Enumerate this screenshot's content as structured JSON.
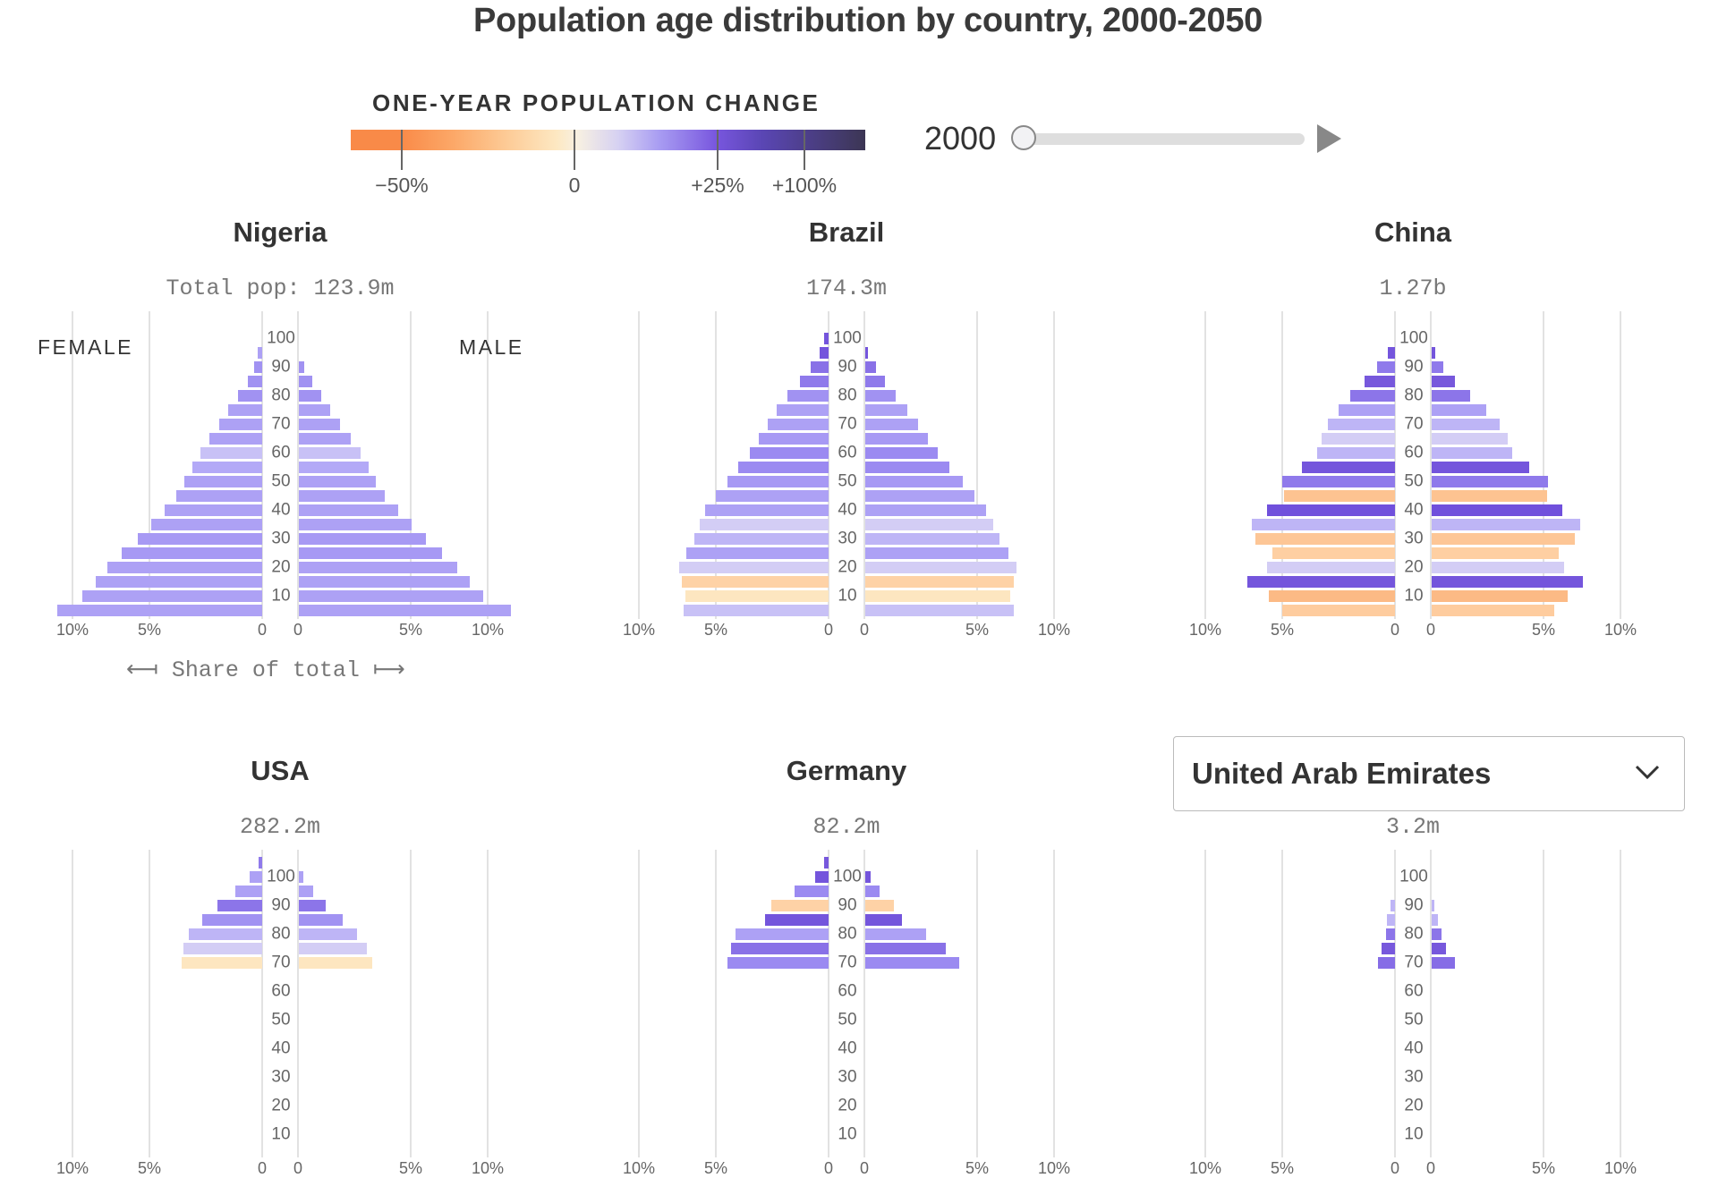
{
  "title": "Population age distribution by country, 2000-2050",
  "legend": {
    "title": "ONE-YEAR POPULATION CHANGE",
    "ticks": [
      {
        "value": -50,
        "label": "−50%"
      },
      {
        "value": 0,
        "label": "0"
      },
      {
        "value": 25,
        "label": "+25%"
      },
      {
        "value": 100,
        "label": "+100%"
      }
    ],
    "color_stops": [
      {
        "change": -50,
        "color": "#f98a48"
      },
      {
        "change": -15,
        "color": "#fcb781"
      },
      {
        "change": -6,
        "color": "#fed2a6"
      },
      {
        "change": -1,
        "color": "#fdebc6"
      },
      {
        "change": 0,
        "color": "#f6f1e6"
      },
      {
        "change": 2,
        "color": "#d3cdf5"
      },
      {
        "change": 5,
        "color": "#b3a9f7"
      },
      {
        "change": 10,
        "color": "#9582ef"
      },
      {
        "change": 20,
        "color": "#7758dc"
      },
      {
        "change": 25,
        "color": "#7050dc"
      },
      {
        "change": 100,
        "color": "#3c3654"
      }
    ]
  },
  "slider": {
    "year_label": "2000",
    "min": 2000,
    "max": 2050,
    "value": 2000,
    "play_icon": "play-icon"
  },
  "labels": {
    "female": "FEMALE",
    "male": "MALE",
    "share_of_total": "Share of total"
  },
  "dropdown": {
    "selected": "United Arab Emirates",
    "icon": "chevron-down-icon"
  },
  "age_groups": [
    "0-4",
    "5-9",
    "10-14",
    "15-19",
    "20-24",
    "25-29",
    "30-34",
    "35-39",
    "40-44",
    "45-49",
    "50-54",
    "55-59",
    "60-64",
    "65-69",
    "70-74",
    "75-79",
    "80-84",
    "85-89",
    "90-94",
    "95-99",
    "100+"
  ],
  "age_ticks": [
    "10",
    "20",
    "30",
    "40",
    "50",
    "60",
    "70",
    "80",
    "90",
    "100"
  ],
  "x_ticks": {
    "female": [
      "10%",
      "5%",
      "0"
    ],
    "male": [
      "0",
      "5%",
      "10%"
    ]
  },
  "chart_data": [
    {
      "type": "bar",
      "orientation": "population-pyramid",
      "country": "Nigeria",
      "pop_label": "Total pop: 123.9m",
      "xlabel": "Share of total",
      "xlim": [
        0,
        10
      ],
      "x_unit": "% of total population",
      "female": [
        11.1,
        9.3,
        8.4,
        7.6,
        6.7,
        5.7,
        4.9,
        4.1,
        3.5,
        3.04,
        2.63,
        2.24,
        1.82,
        1.39,
        1.0,
        0.64,
        0.31,
        0.15,
        0.07,
        0,
        0
      ],
      "male": [
        11.6,
        9.6,
        8.7,
        7.85,
        6.85,
        5.85,
        5.0,
        4.24,
        3.5,
        2.99,
        2.63,
        2.24,
        1.78,
        1.32,
        0.9,
        0.57,
        0.29,
        0.09,
        0,
        0,
        0
      ],
      "change": [
        6,
        6,
        6,
        6,
        7,
        7,
        6,
        6,
        6,
        6,
        5,
        3,
        6,
        6,
        6,
        8,
        8,
        8,
        6,
        0,
        0
      ]
    },
    {
      "type": "bar",
      "orientation": "population-pyramid",
      "country": "Brazil",
      "pop_label": "174.3m",
      "xlim": [
        0,
        10
      ],
      "female": [
        7.0,
        6.85,
        7.08,
        7.25,
        6.8,
        6.3,
        5.96,
        5.64,
        5.0,
        4.34,
        3.7,
        3.08,
        2.63,
        2.2,
        1.78,
        1.32,
        0.81,
        0.42,
        0.17,
        0.07,
        0
      ],
      "male": [
        7.2,
        6.96,
        7.2,
        7.37,
        6.9,
        6.3,
        5.9,
        5.5,
        4.8,
        4.14,
        3.4,
        2.76,
        2.28,
        1.82,
        1.35,
        0.87,
        0.5,
        0.22,
        0.03,
        0,
        0
      ],
      "change": [
        3,
        -2,
        -6,
        2,
        6,
        4,
        2,
        6,
        6,
        7,
        9,
        9,
        7,
        6,
        6,
        8,
        12,
        14,
        22,
        22,
        0
      ]
    },
    {
      "type": "bar",
      "orientation": "population-pyramid",
      "country": "China",
      "pop_label": "1.27b",
      "xlim": [
        0,
        10
      ],
      "female": [
        5.0,
        5.8,
        7.14,
        5.9,
        5.6,
        6.63,
        6.9,
        5.9,
        4.9,
        5.0,
        3.85,
        3.04,
        2.8,
        2.5,
        1.97,
        1.47,
        0.87,
        0.42,
        0.13,
        0,
        0
      ],
      "male": [
        5.6,
        6.4,
        7.42,
        6.18,
        5.85,
        6.9,
        7.2,
        6.1,
        5.16,
        5.2,
        4.1,
        3.2,
        2.94,
        2.56,
        1.9,
        1.2,
        0.6,
        0.24,
        0.05,
        0,
        0
      ],
      "change": [
        -8,
        -14,
        22,
        2,
        -7,
        -10,
        4,
        25,
        -11,
        12,
        22,
        4,
        2,
        4,
        6,
        13,
        20,
        12,
        22,
        0,
        0
      ]
    },
    {
      "type": "bar",
      "orientation": "population-pyramid",
      "country": "USA",
      "pop_label": "282.2m",
      "xlim": [
        0,
        10
      ],
      "female": [
        null,
        null,
        null,
        null,
        null,
        null,
        null,
        null,
        null,
        null,
        null,
        null,
        null,
        3.2,
        3.08,
        2.8,
        2.16,
        1.47,
        0.75,
        0.26,
        0.05
      ],
      "male": [
        null,
        null,
        null,
        null,
        null,
        null,
        null,
        null,
        null,
        null,
        null,
        null,
        null,
        2.8,
        2.55,
        2.07,
        1.4,
        0.75,
        0.31,
        0.07,
        0
      ],
      "change": [
        null,
        null,
        null,
        null,
        null,
        null,
        null,
        null,
        null,
        null,
        null,
        null,
        null,
        -2,
        2,
        4,
        8,
        13,
        6,
        6,
        12
      ]
    },
    {
      "type": "bar",
      "orientation": "population-pyramid",
      "country": "Germany",
      "pop_label": "82.2m",
      "xlim": [
        0,
        10
      ],
      "female": [
        null,
        null,
        null,
        null,
        null,
        null,
        null,
        null,
        null,
        null,
        null,
        null,
        null,
        4.3,
        4.14,
        3.86,
        2.33,
        2.03,
        1.0,
        0.29,
        0.07
      ],
      "male": [
        null,
        null,
        null,
        null,
        null,
        null,
        null,
        null,
        null,
        null,
        null,
        null,
        null,
        3.9,
        3.2,
        2.2,
        1.12,
        0.81,
        0.33,
        0.09,
        0
      ],
      "change": [
        null,
        null,
        null,
        null,
        null,
        null,
        null,
        null,
        null,
        null,
        null,
        null,
        null,
        9,
        14,
        6,
        22,
        -6,
        9,
        22,
        20
      ]
    },
    {
      "type": "bar",
      "orientation": "population-pyramid",
      "country": "United Arab Emirates",
      "pop_label": "3.2m",
      "xlim": [
        0,
        10
      ],
      "country_selector": true,
      "female": [
        null,
        null,
        null,
        null,
        null,
        null,
        null,
        null,
        null,
        null,
        null,
        null,
        null,
        0.4,
        0.29,
        0.17,
        0.15,
        0.07,
        0,
        0,
        0
      ],
      "male": [
        null,
        null,
        null,
        null,
        null,
        null,
        null,
        null,
        null,
        null,
        null,
        null,
        null,
        0.62,
        0.33,
        0.2,
        0.1,
        0.04,
        0,
        0,
        0
      ],
      "change": [
        null,
        null,
        null,
        null,
        null,
        null,
        null,
        null,
        null,
        null,
        null,
        null,
        null,
        15,
        20,
        13,
        4,
        4,
        0,
        0,
        0
      ]
    }
  ]
}
